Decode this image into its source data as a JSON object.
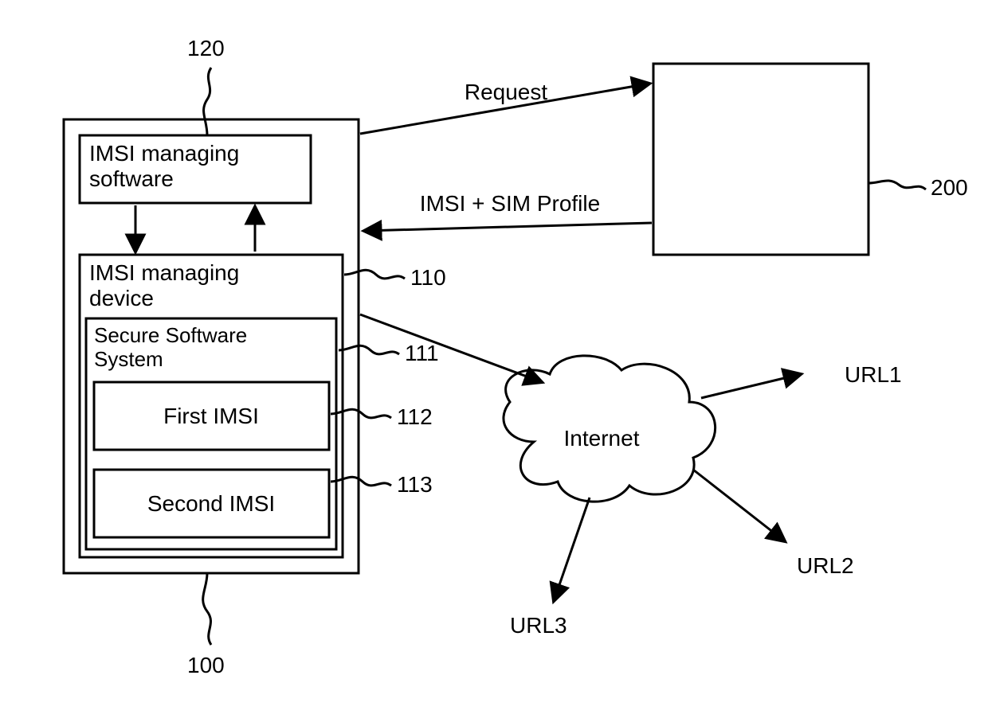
{
  "boxes": {
    "imsi_software": "IMSI managing\nsoftware",
    "imsi_device": "IMSI managing\ndevice",
    "secure_sys": "Secure Software\nSystem",
    "first_imsi": "First IMSI",
    "second_imsi": "Second IMSI"
  },
  "labels": {
    "request": "Request",
    "imsi_profile": "IMSI + SIM Profile",
    "internet": "Internet",
    "url1": "URL1",
    "url2": "URL2",
    "url3": "URL3"
  },
  "refs": {
    "r120": "120",
    "r110": "110",
    "r111": "111",
    "r112": "112",
    "r113": "113",
    "r100": "100",
    "r200": "200"
  }
}
